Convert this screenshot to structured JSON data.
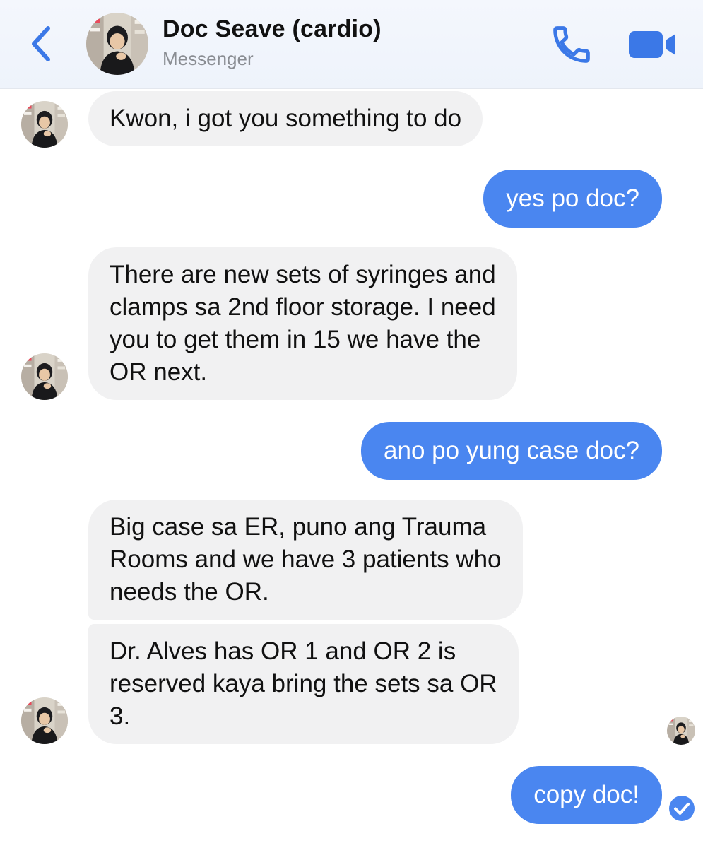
{
  "header": {
    "title": "Doc Seave (cardio)",
    "subtitle": "Messenger",
    "back_icon": "chevron-left-icon",
    "call_icon": "phone-icon",
    "video_icon": "video-camera-icon",
    "accent_color": "#3b78e7"
  },
  "messages": [
    {
      "direction": "incoming",
      "text": "Kwon, i got you something to do"
    },
    {
      "direction": "outgoing",
      "text": "yes po doc?"
    },
    {
      "direction": "incoming",
      "text": "There are new sets of syringes and\nclamps sa 2nd floor storage. I need\nyou to get them in 15 we have the\nOR next."
    },
    {
      "direction": "outgoing",
      "text": "ano po yung case doc?"
    },
    {
      "direction": "incoming",
      "text": "Big case sa ER, puno ang Trauma\nRooms and we have 3 patients who\nneeds the OR."
    },
    {
      "direction": "incoming",
      "text": "Dr. Alves has OR 1 and OR 2 is\nreserved kaya bring the sets sa OR\n3."
    },
    {
      "direction": "outgoing",
      "text": "copy doc!"
    }
  ],
  "colors": {
    "incoming_bubble": "#f1f1f2",
    "outgoing_bubble": "#4a86f0",
    "status_check": "#4a86f0"
  },
  "status_icon": "delivered-check-icon"
}
